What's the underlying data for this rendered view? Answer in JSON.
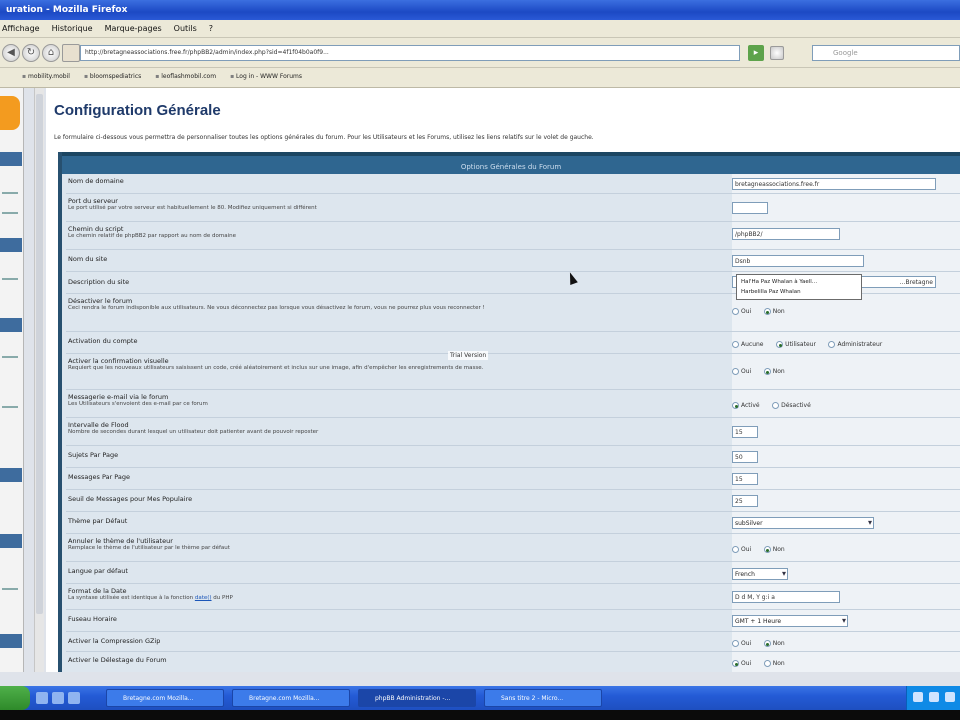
{
  "window": {
    "title": "uration - Mozilla Firefox"
  },
  "menu": [
    "Affichage",
    "Historique",
    "Marque-pages",
    "Outils",
    "?"
  ],
  "nav": {
    "url": "http://bretagneassociations.free.fr/phpBB2/admin/index.php?sid=4f1f04b0a0f9...",
    "search_placeholder": "Google"
  },
  "bookmarks": [
    "mobility.mobil",
    "bloomspediatrics",
    "leoflashmobil.com",
    "Log in - WWW Forums"
  ],
  "page": {
    "title": "Configuration Générale",
    "intro": "Le formulaire ci-dessous vous permettra de personnaliser toutes les options générales du forum. Pour les Utilisateurs et les Forums, utilisez les liens relatifs sur le volet de gauche.",
    "panel_title": "Options Générales du Forum"
  },
  "rows": {
    "domain": {
      "label": "Nom de domaine",
      "value": "bretagneassociations.free.fr"
    },
    "port": {
      "label": "Port du serveur",
      "desc": "Le port utilisé par votre serveur est habituellement le 80. Modifiez uniquement si différent",
      "value": ""
    },
    "script": {
      "label": "Chemin du script",
      "desc": "Le chemin relatif de phpBB2 par rapport au nom de domaine",
      "value": "/phpBB2/"
    },
    "sitename": {
      "label": "Nom du site",
      "value": "Dsnb"
    },
    "sitedesc": {
      "label": "Description du site",
      "value": "...Bretagne"
    },
    "disable": {
      "label": "Désactiver le forum",
      "desc": "Ceci rendra le forum indisponible aux utilisateurs. Ne vous déconnectez pas lorsque vous désactivez le forum, vous ne pourrez plus vous reconnecter !",
      "opt_yes": "Oui",
      "opt_no": "Non"
    },
    "activation": {
      "label": "Activation du compte",
      "opt_none": "Aucune",
      "opt_user": "Utilisateur",
      "opt_admin": "Administrateur"
    },
    "visual": {
      "label": "Activer la confirmation visuelle",
      "desc": "Requiert que les nouveaux utilisateurs saisissent un code, créé aléatoirement et inclus sur une image, afin d'empêcher les enregistrements de masse.",
      "opt_yes": "Oui",
      "opt_no": "Non"
    },
    "mail": {
      "label": "Messagerie e-mail via le forum",
      "desc": "Les Utilisateurs s'envoient des e-mail par ce forum",
      "opt_on": "Activé",
      "opt_off": "Désactivé"
    },
    "flood": {
      "label": "Intervalle de Flood",
      "desc": "Nombre de secondes durant lesquel un utilisateur doit patienter avant de pouvoir reposter",
      "value": "15"
    },
    "topics": {
      "label": "Sujets Par Page",
      "value": "50"
    },
    "posts": {
      "label": "Messages Par Page",
      "value": "15"
    },
    "hot": {
      "label": "Seuil de Messages pour Mes Populaire",
      "value": "25"
    },
    "theme": {
      "label": "Thème par Défaut",
      "value": "subSilver"
    },
    "override": {
      "label": "Annuler le thème de l'utilisateur",
      "desc": "Remplace le thème de l'utilisateur par le thème par défaut",
      "opt_yes": "Oui",
      "opt_no": "Non"
    },
    "lang": {
      "label": "Langue par défaut",
      "value": "French"
    },
    "date": {
      "label": "Format de la Date",
      "desc_pre": "La syntaxe utilisée est identique à la fonction",
      "desc_link": "date()",
      "desc_post": "du PHP",
      "value": "D d M, Y g:i a"
    },
    "tz": {
      "label": "Fuseau Horaire",
      "value": "GMT + 1 Heure"
    },
    "gzip": {
      "label": "Activer la Compression GZip",
      "opt_yes": "Oui",
      "opt_no": "Non"
    },
    "prune": {
      "label": "Activer le Délestage du Forum",
      "opt_yes": "Oui",
      "opt_no": "Non"
    }
  },
  "autocomplete": [
    "Hal'Ha Paz Whalan à Yaell...",
    "Harbelilla Paz Whalan"
  ],
  "trial": "Trial Version",
  "taskbar": [
    "Bretagne.com Mozilla...",
    "Bretagne.com Mozilla...",
    "phpBB Administration -...",
    "Sans titre 2 - Micro..."
  ]
}
